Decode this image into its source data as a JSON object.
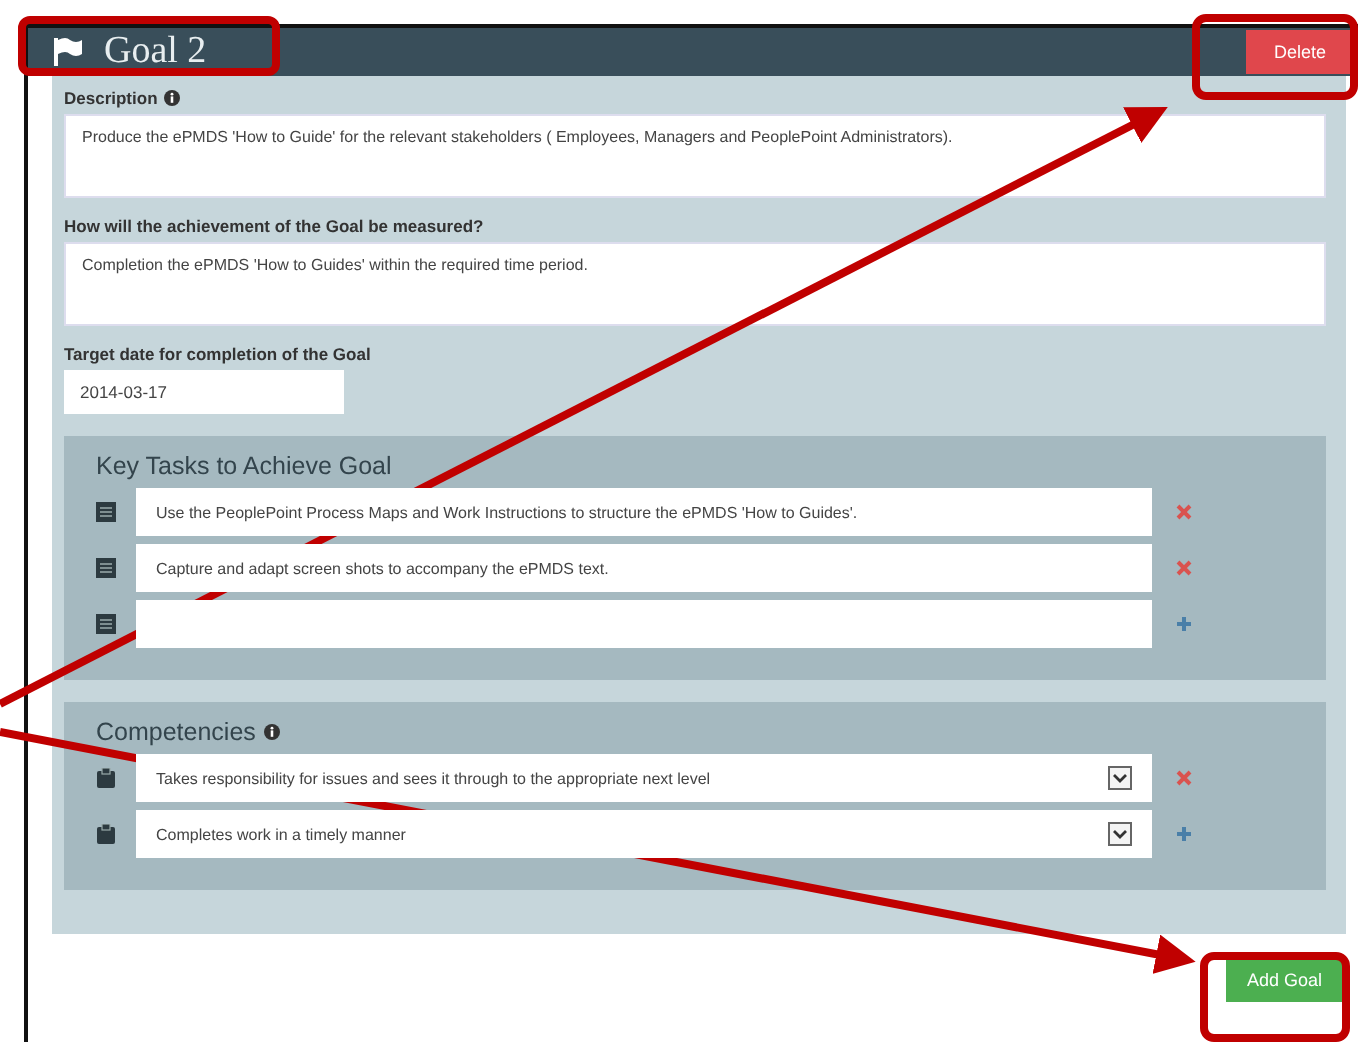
{
  "goal": {
    "title": "Goal  2",
    "delete_button": "Delete"
  },
  "description": {
    "label": "Description",
    "value": "Produce the ePMDS 'How to Guide' for the relevant stakeholders ( Employees, Managers and PeoplePoint Administrators)."
  },
  "measure": {
    "label": "How will the achievement of the Goal be measured?",
    "value": "Completion the ePMDS 'How to Guides' within the required time period."
  },
  "target_date": {
    "label": "Target date for completion of the Goal",
    "value": "2014-03-17"
  },
  "key_tasks": {
    "title": "Key Tasks to Achieve Goal",
    "items": [
      {
        "value": "Use the PeoplePoint Process Maps and Work Instructions to structure the ePMDS 'How to Guides'.",
        "kind": "remove"
      },
      {
        "value": "Capture and adapt screen shots to accompany the ePMDS text.",
        "kind": "remove"
      },
      {
        "value": "",
        "kind": "add"
      }
    ]
  },
  "competencies": {
    "title": "Competencies",
    "items": [
      {
        "value": "Takes responsibility for issues and sees it through to the appropriate next level",
        "kind": "remove"
      },
      {
        "value": "Completes work in a timely manner",
        "kind": "add"
      }
    ]
  },
  "add_goal_button": "Add Goal"
}
